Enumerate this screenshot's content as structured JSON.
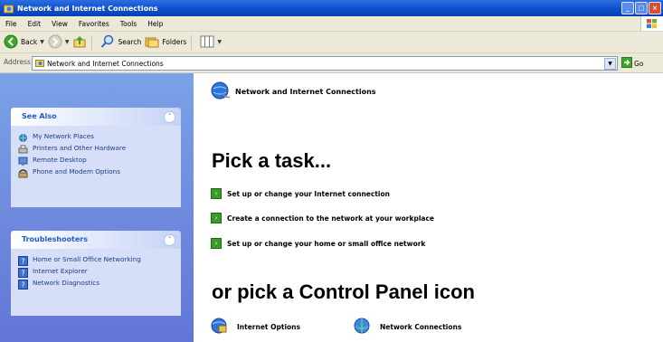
{
  "window": {
    "title": "Network and Internet Connections",
    "controls": [
      "minimize",
      "maximize",
      "close"
    ]
  },
  "menu": {
    "items": [
      "File",
      "Edit",
      "View",
      "Favorites",
      "Tools",
      "Help"
    ]
  },
  "toolbar": {
    "back_label": "Back",
    "search_label": "Search",
    "folders_label": "Folders"
  },
  "address": {
    "label": "Address",
    "value": "Network and Internet Connections",
    "go_label": "Go"
  },
  "see_also": {
    "title": "See Also",
    "items": [
      {
        "label": "My Network Places",
        "icon": "network-places-icon"
      },
      {
        "label": "Printers and Other Hardware",
        "icon": "printer-icon"
      },
      {
        "label": "Remote Desktop",
        "icon": "remote-desktop-icon"
      },
      {
        "label": "Phone and Modem Options",
        "icon": "phone-icon"
      }
    ]
  },
  "troubleshooters": {
    "title": "Troubleshooters",
    "items": [
      {
        "label": "Home or Small Office Networking",
        "icon": "help-icon"
      },
      {
        "label": "Internet Explorer",
        "icon": "help-icon"
      },
      {
        "label": "Network Diagnostics",
        "icon": "help-icon"
      }
    ]
  },
  "main": {
    "header": "Network and Internet Connections",
    "pick_task": "Pick a task...",
    "tasks": [
      "Set up or change your Internet connection",
      "Create a connection to the network at your workplace",
      "Set up or change your home or small office network"
    ],
    "or_pick": "or pick a Control Panel icon",
    "icons": [
      "Internet Options",
      "Network Connections"
    ]
  },
  "colors": {
    "titlebar": "#0b4fd0",
    "sidebar": "#6375d6",
    "sidebar_box": "#d6dff7",
    "link": "#215dc6",
    "task_arrow": "#3a9b2a"
  }
}
